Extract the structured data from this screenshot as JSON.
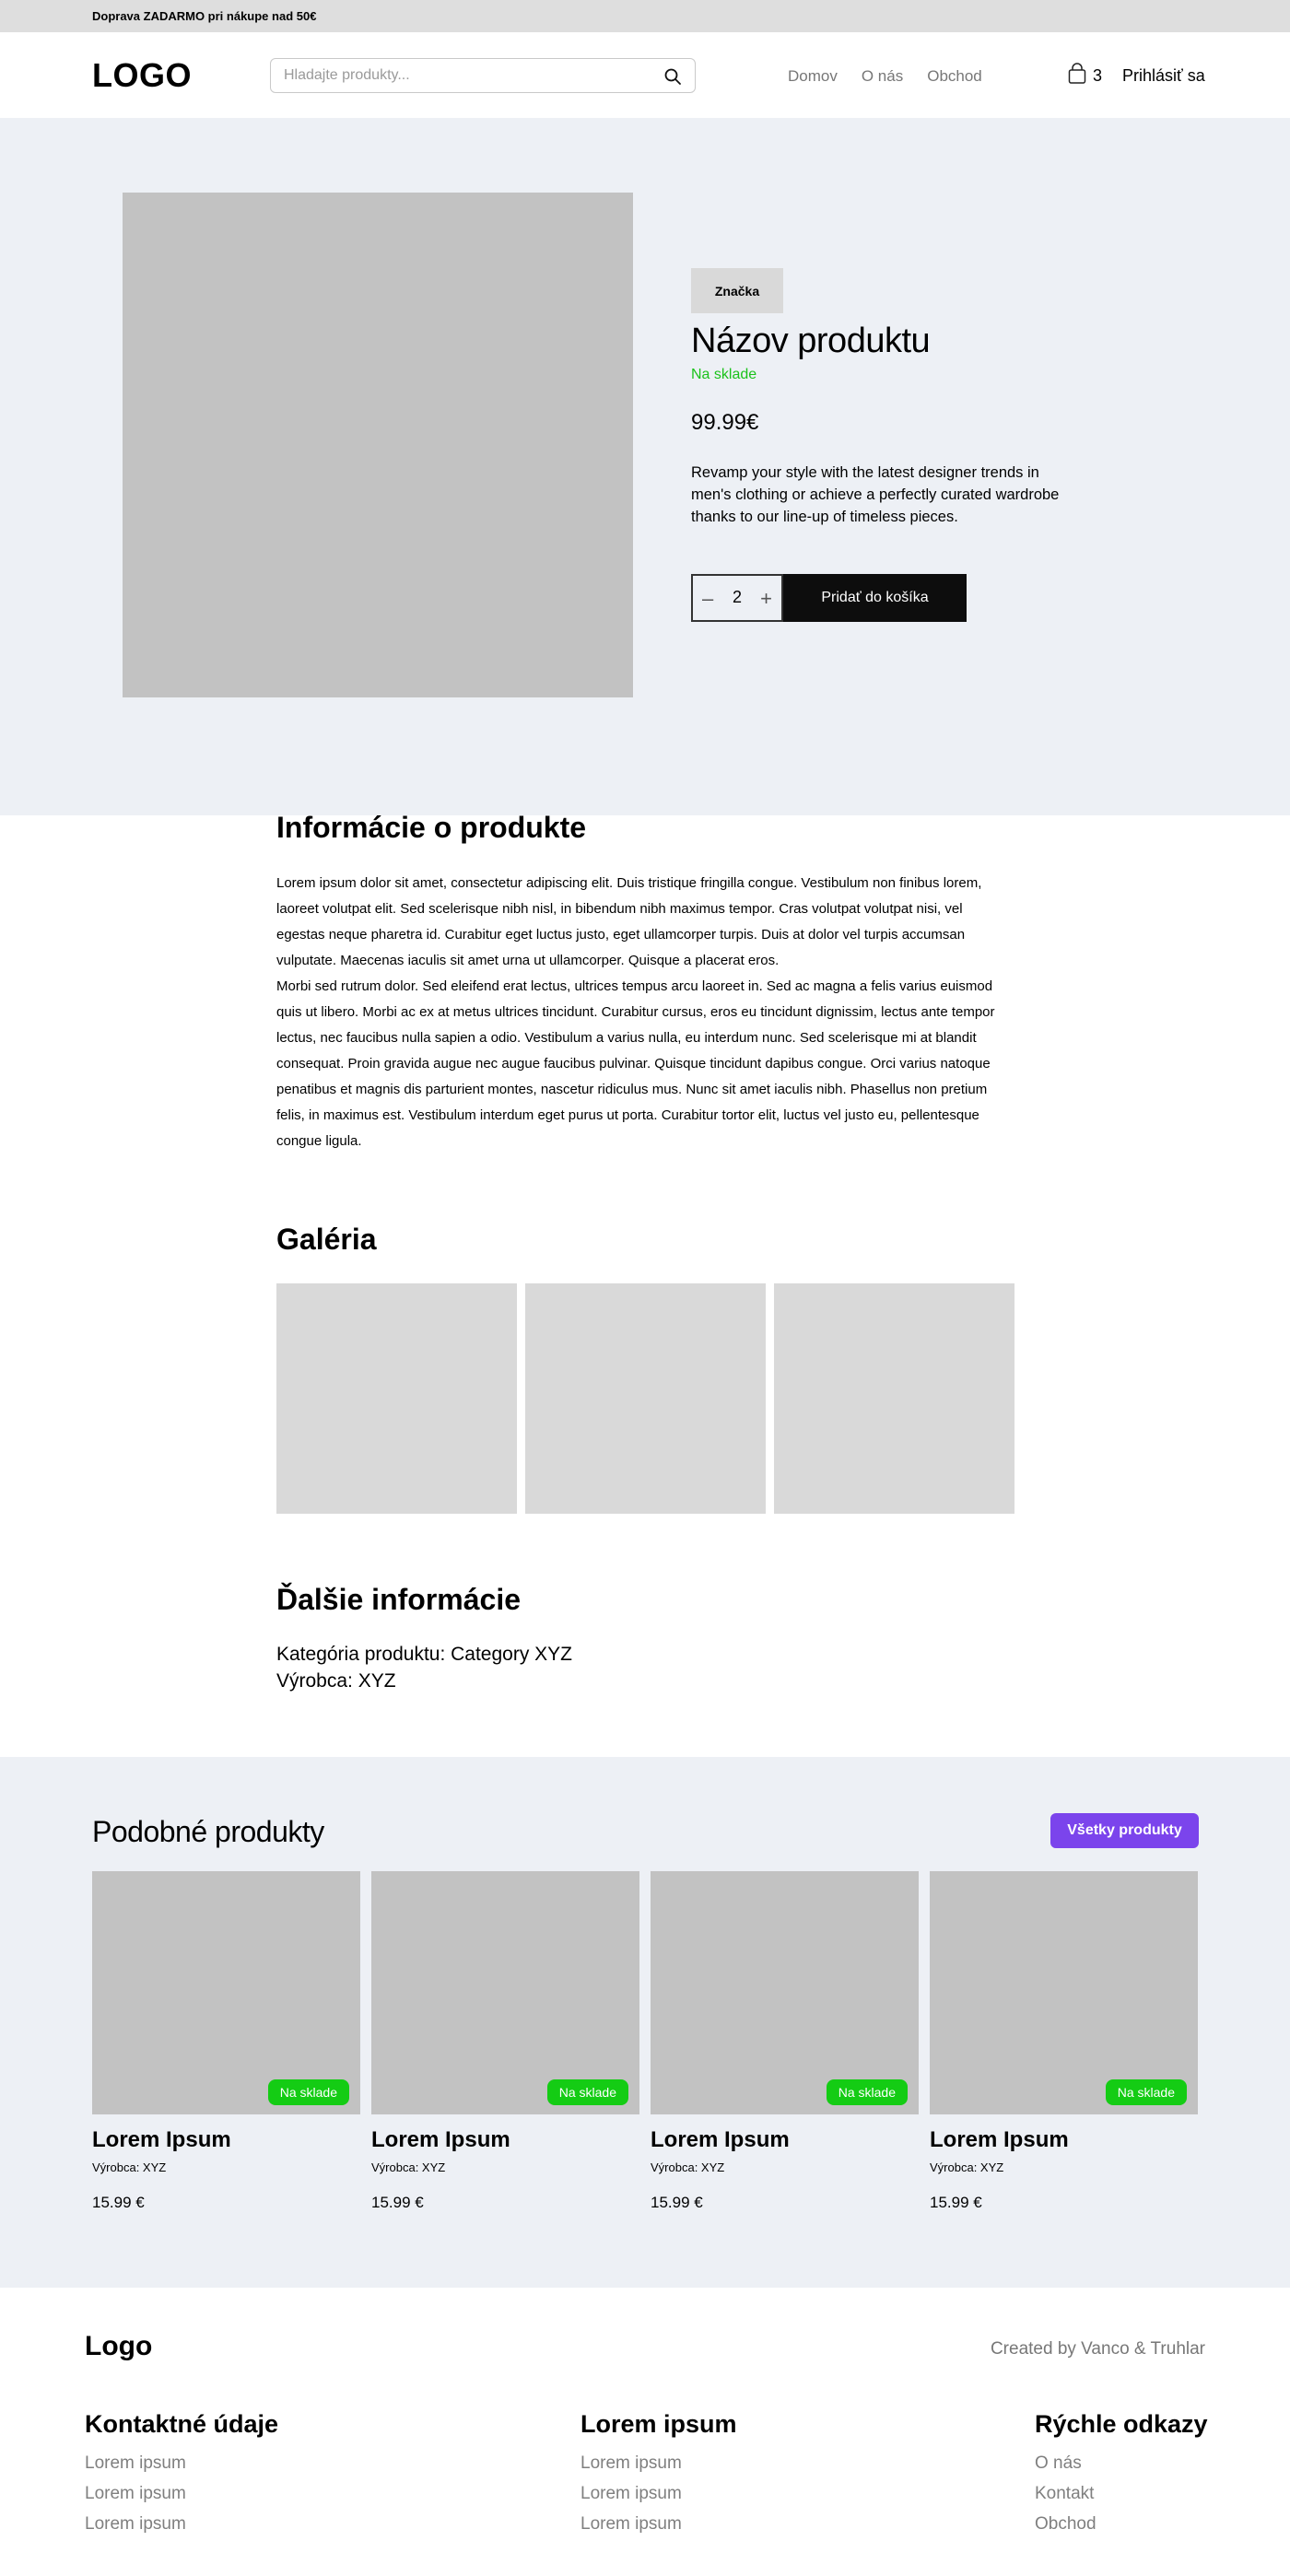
{
  "topbar": {
    "promo": "Doprava ZADARMO pri  nákupe nad 50€"
  },
  "header": {
    "logo": "LOGO",
    "search_placeholder": "Hladajte produkty...",
    "nav": [
      "Domov",
      "O nás",
      "Obchod"
    ],
    "cart_count": "3",
    "login": "Prihlásiť sa"
  },
  "product": {
    "brand": "Značka",
    "title": "Názov produktu",
    "stock": "Na sklade",
    "price": "99.99€",
    "description": "Revamp your style with the latest designer trends in men's clothing or achieve a perfectly curated wardrobe thanks to our line-up of timeless pieces.",
    "quantity": "2",
    "minus": "–",
    "plus": "+",
    "add_to_cart": "Pridať do košíka"
  },
  "info": {
    "title": "Informácie o produkte",
    "paragraph1": "Lorem ipsum dolor sit amet, consectetur adipiscing elit. Duis tristique fringilla congue. Vestibulum non finibus lorem, laoreet volutpat elit. Sed scelerisque nibh nisl, in bibendum nibh maximus tempor. Cras volutpat volutpat nisi, vel egestas neque pharetra id. Curabitur eget luctus justo, eget ullamcorper turpis. Duis at dolor vel turpis accumsan vulputate. Maecenas iaculis sit amet urna ut ullamcorper. Quisque a placerat eros.",
    "paragraph2": "Morbi sed rutrum dolor. Sed eleifend erat lectus, ultrices tempus arcu laoreet in. Sed ac magna a felis varius euismod quis ut libero. Morbi ac ex at metus ultrices tincidunt. Curabitur cursus, eros eu tincidunt dignissim, lectus ante tempor lectus, nec faucibus nulla sapien a odio. Vestibulum a varius nulla, eu interdum nunc. Sed scelerisque mi at blandit consequat. Proin gravida augue nec augue faucibus pulvinar. Quisque tincidunt dapibus congue. Orci varius natoque penatibus et magnis dis parturient montes, nascetur ridiculus mus. Nunc sit amet iaculis nibh. Phasellus non pretium felis, in maximus est. Vestibulum interdum eget purus ut porta. Curabitur tortor elit, luctus vel justo eu, pellentesque congue ligula."
  },
  "gallery": {
    "title": "Galéria"
  },
  "more": {
    "title": "Ďalšie informácie",
    "category": "Kategória produktu:  Category XYZ",
    "maker": "Výrobca: XYZ"
  },
  "similar": {
    "title": "Podobné produkty",
    "all_button": "Všetky produkty",
    "products": [
      {
        "name": "Lorem Ipsum",
        "maker": "Výrobca: XYZ",
        "price": "15.99 €",
        "badge": "Na sklade"
      },
      {
        "name": "Lorem Ipsum",
        "maker": "Výrobca: XYZ",
        "price": "15.99 €",
        "badge": "Na sklade"
      },
      {
        "name": "Lorem Ipsum",
        "maker": "Výrobca: XYZ",
        "price": "15.99 €",
        "badge": "Na sklade"
      },
      {
        "name": "Lorem Ipsum",
        "maker": "Výrobca: XYZ",
        "price": "15.99 €",
        "badge": "Na sklade"
      }
    ]
  },
  "footer": {
    "logo": "Logo",
    "credit": "Created by Vanco & Truhlar",
    "columns": [
      {
        "title": "Kontaktné údaje",
        "links": [
          "Lorem ipsum",
          "Lorem ipsum",
          "Lorem ipsum"
        ]
      },
      {
        "title": "Lorem ipsum",
        "links": [
          "Lorem ipsum",
          "Lorem ipsum",
          "Lorem ipsum"
        ]
      },
      {
        "title": "Rýchle odkazy",
        "links": [
          "O nás",
          "Kontakt",
          "Obchod"
        ]
      }
    ]
  },
  "colors": {
    "accent": "#7b44ec",
    "in_stock": "#14cc14",
    "background_light": "#edf0f5",
    "button_dark": "#0d0d0d"
  },
  "icons": {
    "search": "search-icon",
    "cart": "shopping-bag-icon"
  }
}
